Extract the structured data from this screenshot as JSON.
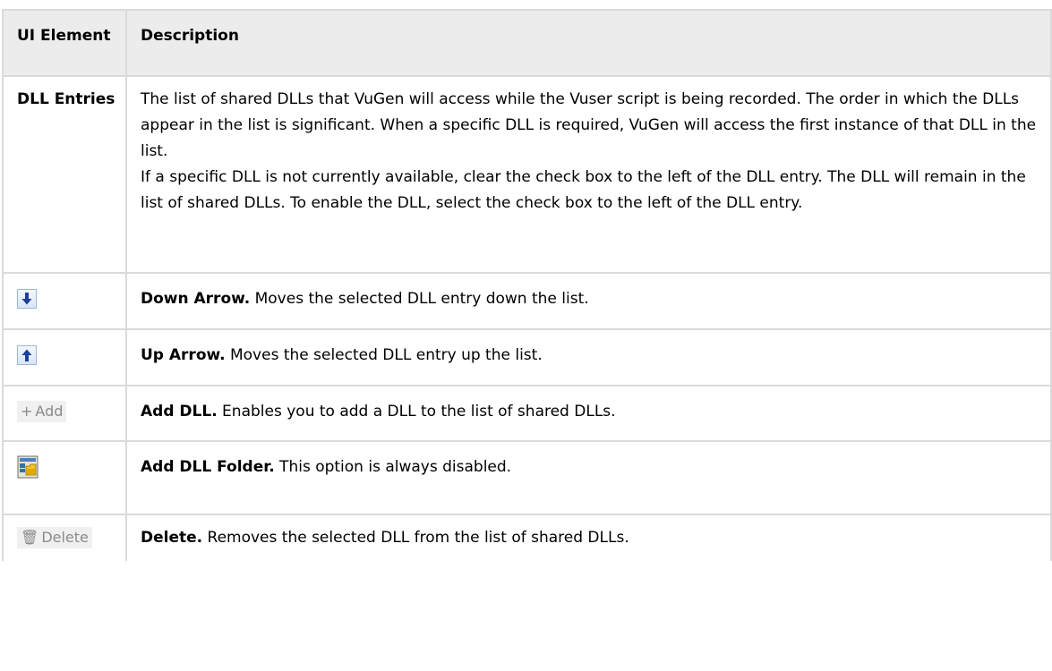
{
  "header": {
    "col1": "UI Element",
    "col2": "Description"
  },
  "rows": {
    "dll_entries": {
      "name": "DLL Entries",
      "paragraphs": [
        "The list of shared DLLs that VuGen will access while the Vuser script is being recorded. The order in which the DLLs appear in the list is significant. When a specific DLL is required, VuGen will access the first instance of that DLL in the list.",
        "If a specific DLL is not currently available, clear the check box to the left of the DLL entry. The DLL will remain in the list of shared DLLs. To enable the DLL, select the check box to the left of the DLL entry."
      ]
    },
    "down_arrow": {
      "icon": "down-arrow-icon",
      "lead": "Down Arrow.",
      "text": " Moves the selected DLL entry down the list."
    },
    "up_arrow": {
      "icon": "up-arrow-icon",
      "lead": "Up Arrow.",
      "text": " Moves the selected DLL entry up the list."
    },
    "add_dll": {
      "button_label": "Add",
      "icon": "plus-icon",
      "lead": "Add DLL.",
      "text": " Enables you to add a DLL to the list of shared DLLs."
    },
    "add_folder": {
      "icon": "add-folder-icon",
      "lead": "Add DLL Folder.",
      "text": " This option is always disabled."
    },
    "delete": {
      "button_label": "Delete",
      "icon": "trash-icon",
      "lead": "Delete.",
      "text": " Removes the selected DLL from the list of shared DLLs."
    }
  },
  "colors": {
    "header_bg": "#ececec",
    "border": "#dadada",
    "arrow_blue": "#1a3f9c",
    "disabled_text": "#8a8a8a"
  }
}
